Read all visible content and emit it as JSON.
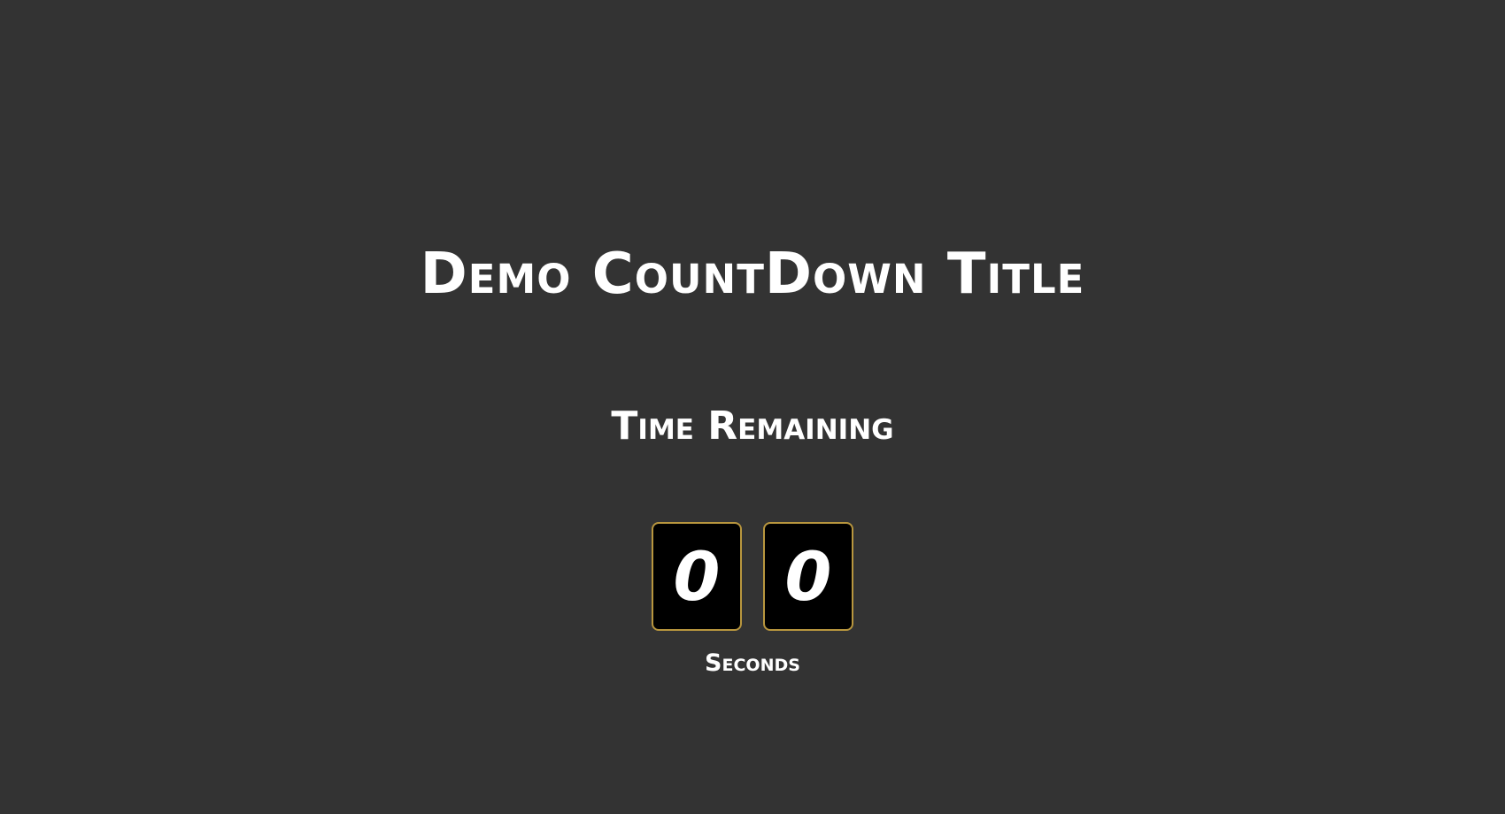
{
  "page": {
    "title": "Demo CountDown Title",
    "subtitle": "Time Remaining"
  },
  "countdown": {
    "digits": [
      "0",
      "0"
    ],
    "unit_label": "Seconds"
  },
  "colors": {
    "background": "#333333",
    "card_background": "#000000",
    "card_border": "#b8963e",
    "text": "#ffffff"
  }
}
